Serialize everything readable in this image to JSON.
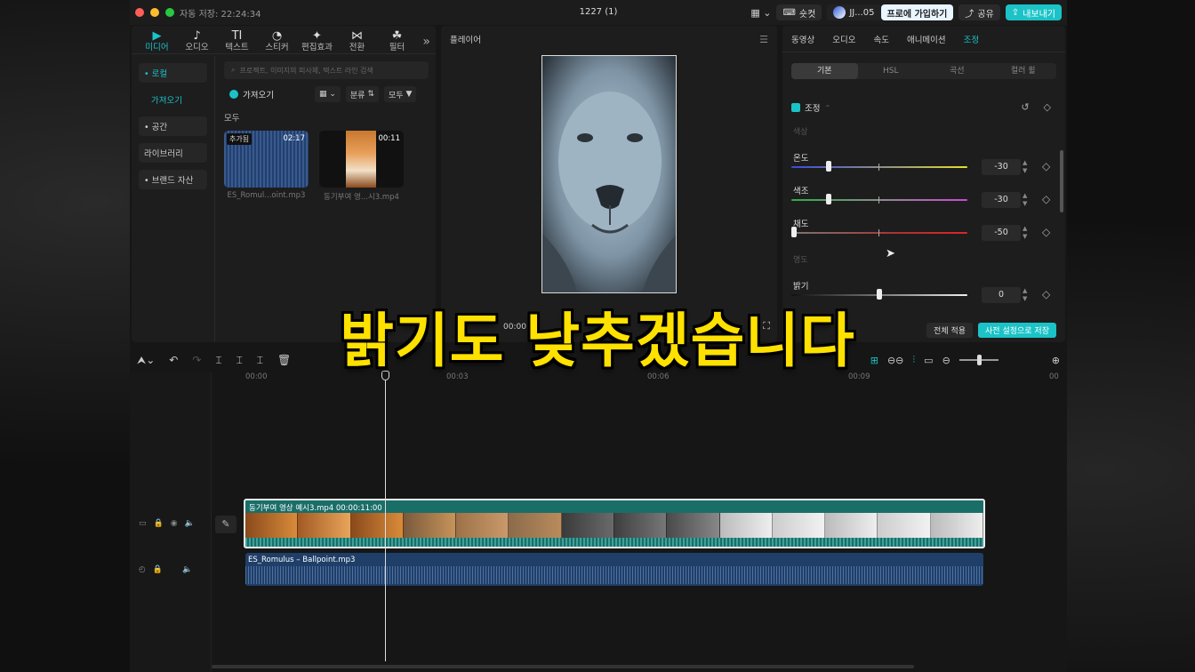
{
  "titlebar": {
    "autosave": "자동 저장: 22:24:34",
    "project_title": "1227 (1)",
    "shortcuts_label": "숏컷",
    "user_label": "JJ...05",
    "join_pro_label": "프로에 가입하기",
    "share_label": "공유",
    "export_label": "내보내기"
  },
  "media_tools": [
    {
      "label": "미디어",
      "icon": "▶"
    },
    {
      "label": "오디오",
      "icon": "♪"
    },
    {
      "label": "텍스트",
      "icon": "TI"
    },
    {
      "label": "스티커",
      "icon": "◔"
    },
    {
      "label": "편집효과",
      "icon": "✦"
    },
    {
      "label": "전환",
      "icon": "⋈"
    },
    {
      "label": "필터",
      "icon": "☘"
    }
  ],
  "media_sidebar": {
    "local": "• 로컬",
    "import": "가져오기",
    "space": "• 공간",
    "library": "라이브러리",
    "brand": "• 브랜드 자산"
  },
  "media_panel": {
    "search_placeholder": "프로젝트, 이미지의 피사체, 텍스트 라인 검색",
    "import_label": "가져오기",
    "sort_label": "분류",
    "all_filter_label": "모두",
    "section_label": "모두",
    "items": [
      {
        "badge": "추가됨",
        "duration": "02:17",
        "name": "ES_Romul...oint.mp3"
      },
      {
        "duration": "00:11",
        "name": "동기부여 영...시3.mp4"
      }
    ]
  },
  "player": {
    "title": "플레이어",
    "timecode": "00:00"
  },
  "inspector": {
    "tabs": [
      "동영상",
      "오디오",
      "속도",
      "애니메이션",
      "조정"
    ],
    "active_tab": "조정",
    "subtabs": [
      "기본",
      "HSL",
      "곡선",
      "컬러 휠"
    ],
    "section_title": "조정",
    "group_color": "색상",
    "group_lightness": "명도",
    "params": [
      {
        "label": "온도",
        "value": "-30",
        "fraction": 0.21
      },
      {
        "label": "색조",
        "value": "-30",
        "fraction": 0.21
      },
      {
        "label": "채도",
        "value": "-50",
        "fraction": 0.0
      },
      {
        "label": "밝기",
        "value": "0",
        "fraction": 0.5
      }
    ],
    "apply_all_label": "전체 적용",
    "save_preset_label": "사전 설정으로 저장"
  },
  "timeline": {
    "ruler": [
      "00:00",
      "00:03",
      "00:06",
      "00:09",
      "00"
    ],
    "video_clip_label": "동기부여 영상 예시3.mp4  00:00:11:00",
    "audio_clip_label": "ES_Romulus – Ballpoint.mp3"
  },
  "caption": "밝기도 낮추겠습니다",
  "colors": {
    "accent": "#1bc3c7",
    "caption": "#ffe100"
  }
}
